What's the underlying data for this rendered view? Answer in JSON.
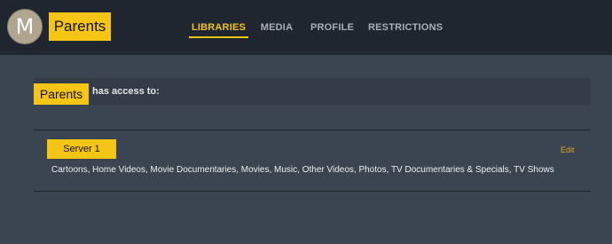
{
  "header": {
    "avatar_letter": "M",
    "user_name": "Parents",
    "tabs": [
      {
        "label": "LIBRARIES",
        "active": true
      },
      {
        "label": "MEDIA",
        "active": false
      },
      {
        "label": "PROFILE",
        "active": false
      },
      {
        "label": "RESTRICTIONS",
        "active": false
      }
    ]
  },
  "access": {
    "user_name": "Parents",
    "text": "has access to:"
  },
  "server": {
    "name": "Server 1",
    "edit_label": "Edit",
    "libraries": "Cartoons, Home Videos, Movie Documentaries, Movies, Music, Other Videos, Photos, TV Documentaries & Specials, TV Shows"
  },
  "colors": {
    "accent": "#f5c516",
    "topbar": "#1f262f",
    "background": "#3b4552",
    "edit": "#e0a31e"
  }
}
